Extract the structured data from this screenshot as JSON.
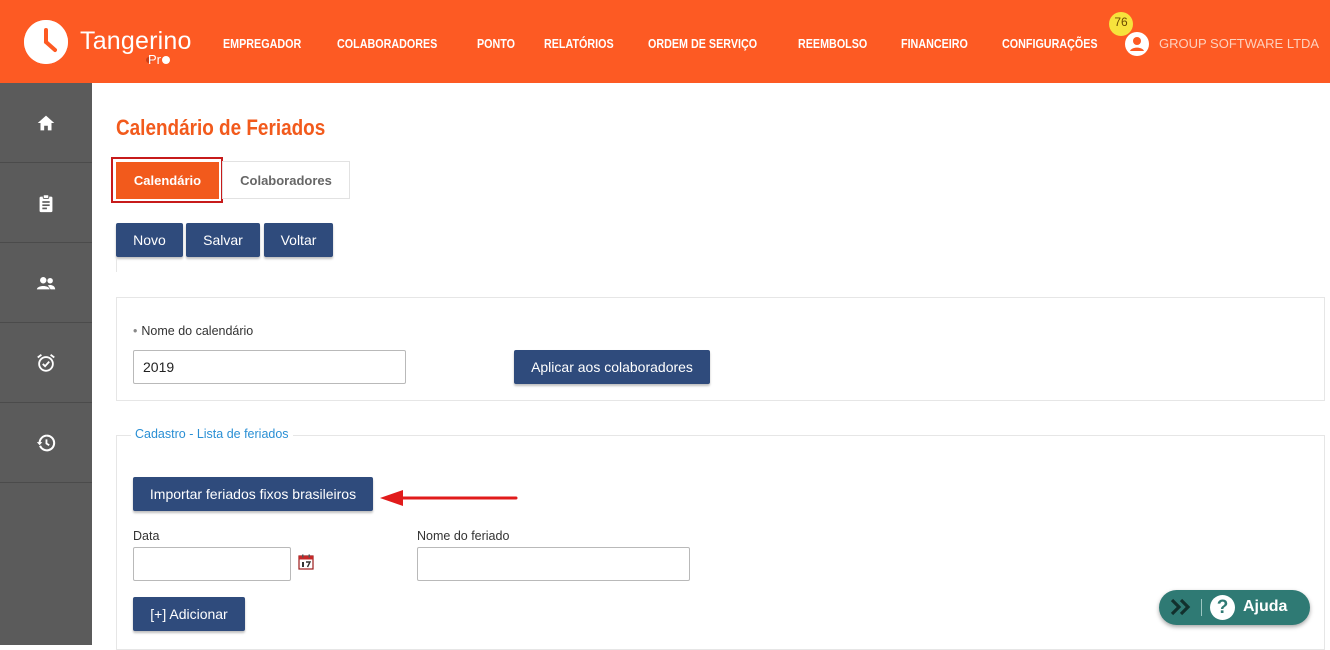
{
  "app": {
    "brand": "Tangerino",
    "brand_suffix": "Pr",
    "accent_color": "#fd5a23"
  },
  "nav": {
    "items": [
      "EMPREGADOR",
      "COLABORADORES",
      "PONTO",
      "RELATÓRIOS",
      "ORDEM DE SERVIÇO",
      "REEMBOLSO",
      "FINANCEIRO",
      "CONFIGURAÇÕES"
    ]
  },
  "user": {
    "notifications": "76",
    "company": "GROUP SOFTWARE LTDA"
  },
  "sidebar": {
    "items": [
      {
        "icon": "home-icon"
      },
      {
        "icon": "clipboard-icon"
      },
      {
        "icon": "people-icon"
      },
      {
        "icon": "alarm-check-icon"
      },
      {
        "icon": "history-icon"
      }
    ]
  },
  "page": {
    "title": "Calendário de Feriados",
    "tabs": [
      {
        "label": "Calendário",
        "active": true
      },
      {
        "label": "Colaboradores",
        "active": false
      }
    ],
    "toolbar": {
      "novo": "Novo",
      "salvar": "Salvar",
      "voltar": "Voltar"
    }
  },
  "calendar_form": {
    "name_label": "Nome do calendário",
    "name_value": "2019",
    "apply_button": "Aplicar aos colaboradores"
  },
  "holidays": {
    "legend": "Cadastro - Lista de feriados",
    "import_button": "Importar feriados fixos brasileiros",
    "date_label": "Data",
    "date_value": "",
    "holiday_name_label": "Nome do feriado",
    "holiday_name_value": "",
    "add_button": "[+] Adicionar"
  },
  "help": {
    "label": "Ajuda"
  }
}
